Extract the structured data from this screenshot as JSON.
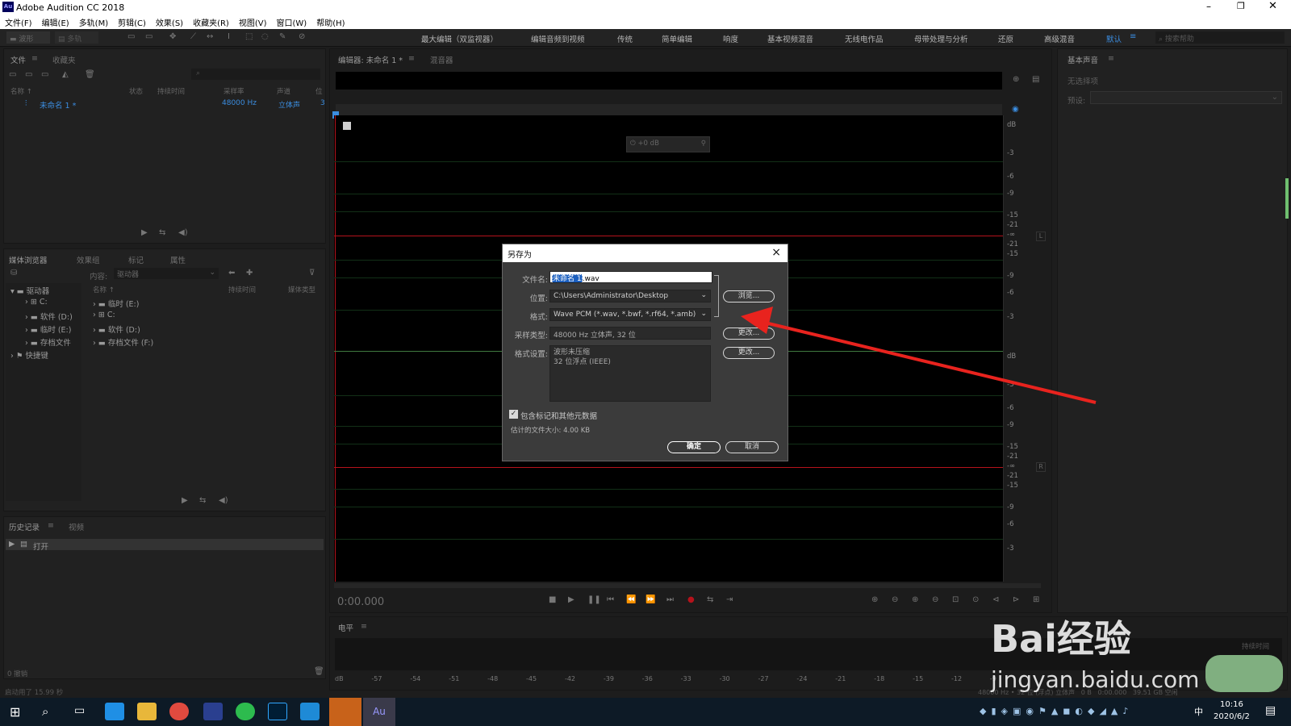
{
  "app": {
    "title": "Adobe Audition CC 2018",
    "icon_label": "Au"
  },
  "menu": [
    "文件(F)",
    "编辑(E)",
    "多轨(M)",
    "剪辑(C)",
    "效果(S)",
    "收藏夹(R)",
    "视图(V)",
    "窗口(W)",
    "帮助(H)"
  ],
  "toolbar": {
    "mode_waveform": "波形",
    "mode_multitrack": "多轨",
    "workspaces": [
      "最大编辑（双监视器）",
      "编辑音频到视频",
      "传统",
      "简单编辑",
      "响度",
      "基本视频混音",
      "无线电作品",
      "母带处理与分析",
      "还原",
      "高级混音",
      "默认"
    ],
    "active_workspace": "默认",
    "search_placeholder": "搜索帮助"
  },
  "files_panel": {
    "tabs": [
      "文件",
      "收藏夹"
    ],
    "columns": [
      "名称 ↑",
      "状态",
      "持续时间",
      "采样率",
      "声道",
      "位"
    ],
    "rows": [
      {
        "name": "未命名 1 *",
        "sample_rate": "48000 Hz",
        "channels": "立体声",
        "bits": "3"
      }
    ]
  },
  "media_browser": {
    "tabs": [
      "媒体浏览器",
      "效果组",
      "标记",
      "属性"
    ],
    "content_label": "内容:",
    "content_value": "驱动器",
    "left_tree": [
      {
        "label": "驱动器"
      },
      {
        "label": "C:"
      },
      {
        "label": "软件 (D:)"
      },
      {
        "label": "临时 (E:)"
      },
      {
        "label": "存档文件"
      },
      {
        "label": "快捷键"
      }
    ],
    "columns": [
      "名称 ↑",
      "持续时间",
      "媒体类型"
    ],
    "right_list": [
      "临时 (E:)",
      "C:",
      "软件 (D:)",
      "存档文件 (F:)"
    ]
  },
  "history_panel": {
    "tabs": [
      "历史记录",
      "视频"
    ],
    "items": [
      "打开"
    ],
    "undo_count": "0 撤销"
  },
  "status_left": "启动用了 15.99 秒",
  "editor": {
    "tabs": [
      "编辑器: 未命名 1 *",
      "混音器"
    ],
    "hud_value": "+0 dB",
    "timecode": "0:00.000",
    "db_labels_top": [
      "dB",
      "-3",
      "-6",
      "-9",
      "-15",
      "-21",
      "-∞",
      "-21",
      "-15",
      "-9",
      "-6",
      "-3"
    ],
    "db_labels_bottom": [
      "dB",
      "-3",
      "-6",
      "-9",
      "-15",
      "-21",
      "-∞",
      "-21",
      "-15",
      "-9",
      "-6",
      "-3"
    ],
    "channel_L": "L",
    "channel_R": "R"
  },
  "levels_panel": {
    "title": "电平",
    "scale": [
      "dB",
      "-57",
      "-54",
      "-51",
      "-48",
      "-45",
      "-42",
      "-39",
      "-36",
      "-33",
      "-30",
      "-27",
      "-24",
      "-21",
      "-18",
      "-15",
      "-12",
      "-9"
    ]
  },
  "right_panel": {
    "title": "基本声音",
    "no_selection": "无选择项",
    "preset_label": "预设:"
  },
  "status_right": {
    "sample": "48000 Hz",
    "format": "32 位 (浮点)",
    "channels": "立体声",
    "size": "0 B",
    "duration": "0:00.000",
    "free": "39.51 GB 空闲",
    "col_label": "持续时间"
  },
  "dialog": {
    "title": "另存为",
    "close": "×",
    "filename_label": "文件名:",
    "filename_selected": "未命名 1",
    "filename_ext": ".wav",
    "location_label": "位置:",
    "location_value": "C:\\Users\\Administrator\\Desktop",
    "browse_button": "浏览...",
    "format_label": "格式:",
    "format_value": "Wave PCM (*.wav, *.bwf, *.rf64, *.amb)",
    "sample_label": "采样类型:",
    "sample_value": "48000 Hz 立体声, 32 位",
    "change_button_1": "更改...",
    "format_settings_label": "格式设置:",
    "format_settings_line1": "波形未压缩",
    "format_settings_line2": "32 位浮点 (IEEE)",
    "change_button_2": "更改...",
    "include_markers_label": "包含标记和其他元数据",
    "include_markers_checked": true,
    "estimated_size": "估计的文件大小: 4.00 KB",
    "ok_button": "确定",
    "cancel_button": "取消"
  },
  "watermark": {
    "brand": "Bai经验",
    "url": "jingyan.baidu.com"
  },
  "taskbar": {
    "time": "10:16",
    "date": "2020/6/2",
    "ime": "中"
  },
  "colors": {
    "accent": "#3b8de0",
    "arrow": "#e8231e",
    "red_line": "#b5121b",
    "green_line": "#1f4d2a"
  }
}
